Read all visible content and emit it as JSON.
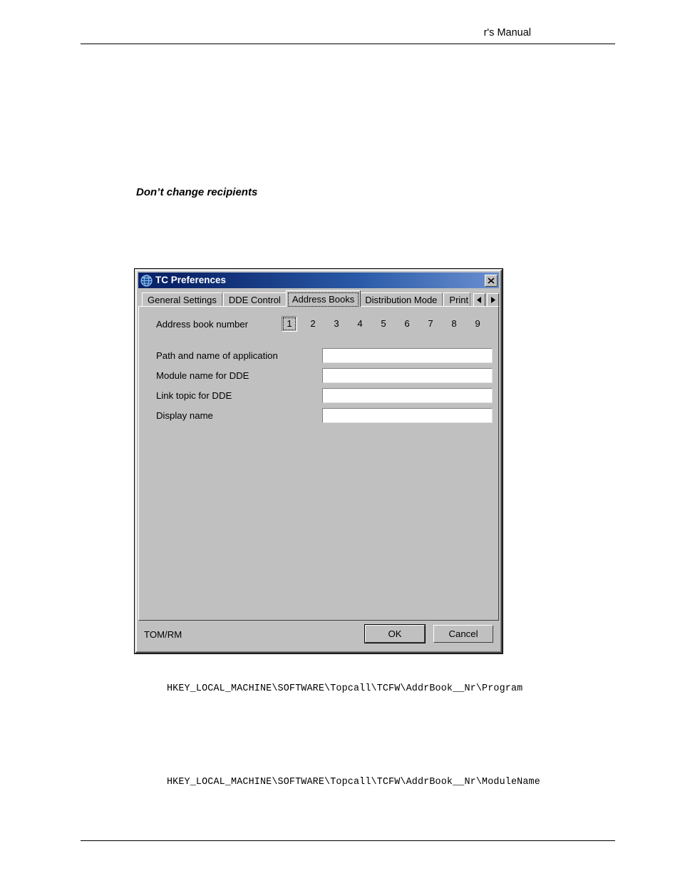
{
  "page": {
    "header_text": "r's Manual",
    "heading": "Don’t change recipients",
    "registry_path_1": "HKEY_LOCAL_MACHINE\\SOFTWARE\\Topcall\\TCFW\\AddrBook__Nr\\Program",
    "registry_path_2": "HKEY_LOCAL_MACHINE\\SOFTWARE\\Topcall\\TCFW\\AddrBook__Nr\\ModuleName"
  },
  "dialog": {
    "title": "TC Preferences",
    "title_icon": "globe-icon",
    "close_label": "×",
    "titlebar_color": "#0a246a",
    "face_color": "#c0c0c0",
    "tabs": [
      {
        "label": "General Settings",
        "active": false
      },
      {
        "label": "DDE Control",
        "active": false
      },
      {
        "label": "Address Books",
        "active": true
      },
      {
        "label": "Distribution Mode",
        "active": false
      },
      {
        "label": "Print Cont",
        "active": false
      }
    ],
    "tab_scroll": {
      "prev_icon": "triangle-left-icon",
      "next_icon": "triangle-right-icon"
    },
    "address_book": {
      "label": "Address book number",
      "numbers": [
        "1",
        "2",
        "3",
        "4",
        "5",
        "6",
        "7",
        "8",
        "9"
      ],
      "selected": "1"
    },
    "fields": [
      {
        "label": "Path and name of application",
        "value": "",
        "placeholder": ""
      },
      {
        "label": "Module name for DDE",
        "value": "",
        "placeholder": ""
      },
      {
        "label": "Link topic for DDE",
        "value": "",
        "placeholder": ""
      },
      {
        "label": "Display name",
        "value": "",
        "placeholder": ""
      }
    ],
    "status": "TOM/RM",
    "buttons": {
      "ok": "OK",
      "cancel": "Cancel"
    }
  }
}
